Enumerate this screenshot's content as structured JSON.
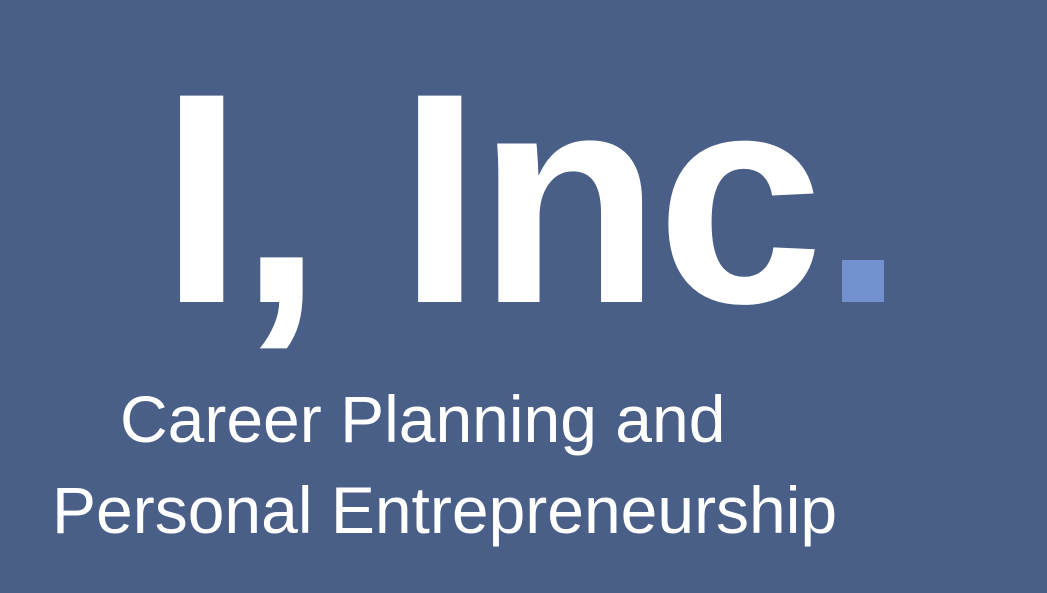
{
  "title": {
    "text": "I, Inc",
    "accent_color": "#7390cf"
  },
  "subtitle": {
    "line1": "Career Planning and",
    "line2": "Personal Entrepreneurship"
  },
  "colors": {
    "background": "#4a5f88",
    "text": "#ffffff"
  }
}
